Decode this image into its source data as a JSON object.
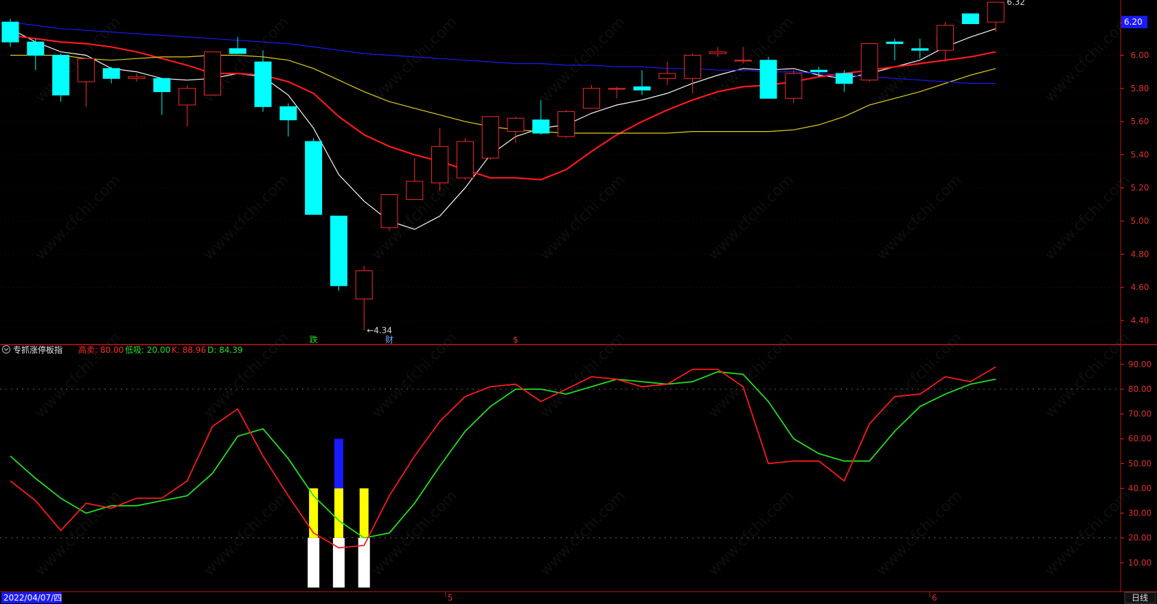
{
  "colors": {
    "background": "#000000",
    "up": "#ff2a2a",
    "down": "#00ffff",
    "ma5": "#ffffff",
    "ma10": "#ff1a1a",
    "ma20": "#e6d21a",
    "ma60": "#1a1aff",
    "k_line": "#ff1a1a",
    "d_line": "#22e022",
    "axis_text": "#e03030",
    "grid": "#7a1010",
    "price_box": "#1a1aff",
    "white_bar": "#ffffff",
    "yellow_bar": "#ffff00",
    "blue_bar": "#1a1aff"
  },
  "header": {
    "indicator_name": "专抓涨停板指",
    "indicator_icon": "collapse-chevron-icon",
    "high_label": "高卖: 80.00",
    "low_label": "低吸: 20.00",
    "k_label": "K: 88.96",
    "d_label": "D: 84.39"
  },
  "price_axis": {
    "current_price_box": "6.20",
    "high_marker": "6.32",
    "low_marker": "←4.34",
    "ticks": [
      "6.00",
      "5.80",
      "5.60",
      "5.40",
      "5.20",
      "5.00",
      "4.80",
      "4.60",
      "4.40",
      "......"
    ]
  },
  "indicator_axis": {
    "ticks": [
      "90.00",
      "80.00",
      "70.00",
      "60.00",
      "50.00",
      "40.00",
      "30.00",
      "20.00",
      "10.00"
    ]
  },
  "markers": [
    {
      "text": "跌",
      "color": "#22e022"
    },
    {
      "text": "财",
      "color": "#6aa8ff"
    },
    {
      "text": "$",
      "color": "#e03030"
    }
  ],
  "bottom": {
    "date_box": "2022/04/07/四",
    "month_labels": [
      "5",
      "6"
    ],
    "period_button": "日线"
  },
  "watermark_text": "www.cfchi.com",
  "chart_data": [
    {
      "type": "candlestick",
      "title": "",
      "ylim": [
        4.28,
        6.3
      ],
      "candles": [
        {
          "o": 6.2,
          "h": 6.22,
          "l": 6.05,
          "c": 6.08
        },
        {
          "o": 6.08,
          "h": 6.1,
          "l": 5.91,
          "c": 6.0
        },
        {
          "o": 6.0,
          "h": 6.01,
          "l": 5.72,
          "c": 5.76
        },
        {
          "o": 5.84,
          "h": 5.98,
          "l": 5.69,
          "c": 5.98
        },
        {
          "o": 5.92,
          "h": 5.93,
          "l": 5.83,
          "c": 5.86
        },
        {
          "o": 5.86,
          "h": 5.89,
          "l": 5.84,
          "c": 5.87
        },
        {
          "o": 5.86,
          "h": 5.86,
          "l": 5.64,
          "c": 5.78
        },
        {
          "o": 5.7,
          "h": 5.82,
          "l": 5.57,
          "c": 5.8
        },
        {
          "o": 5.76,
          "h": 6.02,
          "l": 5.76,
          "c": 6.02
        },
        {
          "o": 6.04,
          "h": 6.11,
          "l": 6.01,
          "c": 6.01
        },
        {
          "o": 5.96,
          "h": 6.03,
          "l": 5.66,
          "c": 5.69
        },
        {
          "o": 5.69,
          "h": 5.71,
          "l": 5.51,
          "c": 5.61
        },
        {
          "o": 5.48,
          "h": 5.5,
          "l": 5.04,
          "c": 5.04
        },
        {
          "o": 5.03,
          "h": 5.03,
          "l": 4.58,
          "c": 4.61
        },
        {
          "o": 4.53,
          "h": 4.73,
          "l": 4.34,
          "c": 4.7
        },
        {
          "o": 4.96,
          "h": 5.16,
          "l": 4.94,
          "c": 5.16
        },
        {
          "o": 5.13,
          "h": 5.38,
          "l": 5.13,
          "c": 5.24
        },
        {
          "o": 5.23,
          "h": 5.56,
          "l": 5.18,
          "c": 5.45
        },
        {
          "o": 5.26,
          "h": 5.5,
          "l": 5.25,
          "c": 5.48
        },
        {
          "o": 5.38,
          "h": 5.63,
          "l": 5.37,
          "c": 5.63
        },
        {
          "o": 5.54,
          "h": 5.63,
          "l": 5.47,
          "c": 5.62
        },
        {
          "o": 5.61,
          "h": 5.73,
          "l": 5.52,
          "c": 5.53
        },
        {
          "o": 5.51,
          "h": 5.67,
          "l": 5.5,
          "c": 5.66
        },
        {
          "o": 5.68,
          "h": 5.82,
          "l": 5.68,
          "c": 5.8
        },
        {
          "o": 5.8,
          "h": 5.81,
          "l": 5.74,
          "c": 5.8
        },
        {
          "o": 5.81,
          "h": 5.91,
          "l": 5.76,
          "c": 5.79
        },
        {
          "o": 5.86,
          "h": 5.96,
          "l": 5.82,
          "c": 5.89
        },
        {
          "o": 5.86,
          "h": 6.01,
          "l": 5.77,
          "c": 6.0
        },
        {
          "o": 6.01,
          "h": 6.05,
          "l": 5.99,
          "c": 6.02
        },
        {
          "o": 5.97,
          "h": 6.05,
          "l": 5.95,
          "c": 5.97
        },
        {
          "o": 5.97,
          "h": 5.99,
          "l": 5.74,
          "c": 5.74
        },
        {
          "o": 5.74,
          "h": 5.91,
          "l": 5.71,
          "c": 5.89
        },
        {
          "o": 5.91,
          "h": 5.93,
          "l": 5.87,
          "c": 5.9
        },
        {
          "o": 5.89,
          "h": 5.91,
          "l": 5.78,
          "c": 5.83
        },
        {
          "o": 5.85,
          "h": 6.07,
          "l": 5.84,
          "c": 6.07
        },
        {
          "o": 6.08,
          "h": 6.1,
          "l": 5.97,
          "c": 6.07
        },
        {
          "o": 6.04,
          "h": 6.1,
          "l": 5.98,
          "c": 6.03
        },
        {
          "o": 6.03,
          "h": 6.2,
          "l": 5.96,
          "c": 6.18
        },
        {
          "o": 6.25,
          "h": 6.25,
          "l": 6.19,
          "c": 6.19
        },
        {
          "o": 6.2,
          "h": 6.32,
          "l": 6.14,
          "c": 6.32
        }
      ],
      "series": [
        {
          "values": [
            6.16,
            6.08,
            6.02,
            6.0,
            5.92,
            5.9,
            5.86,
            5.85,
            5.86,
            5.89,
            5.87,
            5.76,
            5.56,
            5.28,
            5.12,
            5.0,
            4.95,
            5.03,
            5.2,
            5.4,
            5.51,
            5.56,
            5.58,
            5.65,
            5.7,
            5.73,
            5.77,
            5.83,
            5.88,
            5.92,
            5.91,
            5.92,
            5.88,
            5.86,
            5.89,
            5.93,
            5.97,
            6.05,
            6.11,
            6.16
          ],
          "color_key": "ma5"
        },
        {
          "values": [
            6.12,
            6.1,
            6.08,
            6.07,
            6.05,
            6.02,
            5.98,
            5.94,
            5.89,
            5.89,
            5.88,
            5.84,
            5.77,
            5.63,
            5.52,
            5.45,
            5.4,
            5.36,
            5.31,
            5.26,
            5.26,
            5.25,
            5.31,
            5.42,
            5.52,
            5.6,
            5.67,
            5.73,
            5.78,
            5.81,
            5.82,
            5.84,
            5.87,
            5.89,
            5.91,
            5.93,
            5.95,
            5.97,
            5.99,
            6.02
          ],
          "color_key": "ma10"
        },
        {
          "values": [
            6.0,
            6.0,
            6.0,
            5.98,
            5.97,
            5.98,
            5.99,
            5.99,
            6.0,
            6.0,
            5.99,
            5.97,
            5.92,
            5.85,
            5.78,
            5.72,
            5.68,
            5.64,
            5.6,
            5.57,
            5.55,
            5.54,
            5.53,
            5.53,
            5.53,
            5.53,
            5.53,
            5.54,
            5.54,
            5.54,
            5.54,
            5.55,
            5.58,
            5.63,
            5.7,
            5.74,
            5.78,
            5.83,
            5.88,
            5.92
          ],
          "color_key": "ma20"
        },
        {
          "values": [
            6.2,
            6.18,
            6.16,
            6.15,
            6.14,
            6.13,
            6.12,
            6.11,
            6.1,
            6.09,
            6.08,
            6.07,
            6.05,
            6.03,
            6.01,
            6.0,
            5.99,
            5.98,
            5.97,
            5.96,
            5.95,
            5.95,
            5.94,
            5.94,
            5.93,
            5.93,
            5.92,
            5.92,
            5.91,
            5.91,
            5.9,
            5.9,
            5.89,
            5.88,
            5.87,
            5.86,
            5.85,
            5.84,
            5.83,
            5.83
          ],
          "color_key": "ma60"
        }
      ]
    },
    {
      "type": "line",
      "title": "专抓涨停板指",
      "ylim": [
        0,
        93
      ],
      "series": [
        {
          "name": "K",
          "values": [
            43,
            35,
            23,
            34,
            32,
            36,
            36,
            43,
            65,
            72,
            53,
            37,
            22,
            16,
            17,
            37,
            53,
            67,
            77,
            81,
            82,
            75,
            80,
            85,
            84,
            81,
            82,
            88,
            88,
            81,
            50,
            51,
            51,
            43,
            66,
            77,
            78,
            85,
            83,
            89
          ],
          "color_key": "k_line"
        },
        {
          "name": "D",
          "values": [
            53,
            44,
            36,
            30,
            33,
            33,
            35,
            37,
            46,
            61,
            64,
            52,
            37,
            27,
            20,
            22,
            34,
            49,
            63,
            73,
            80,
            80,
            78,
            81,
            84,
            83,
            82,
            83,
            87,
            86,
            75,
            60,
            54,
            51,
            51,
            63,
            73,
            78,
            82,
            84
          ],
          "color_key": "d_line"
        }
      ],
      "signal_bars": [
        {
          "index": 12,
          "white": 20,
          "yellow": 40,
          "blue": null
        },
        {
          "index": 13,
          "white": 20,
          "yellow": 40,
          "blue": 60
        },
        {
          "index": 14,
          "white": 20,
          "yellow": 40,
          "blue": null
        }
      ],
      "reference_lines": [
        20,
        80
      ]
    }
  ]
}
